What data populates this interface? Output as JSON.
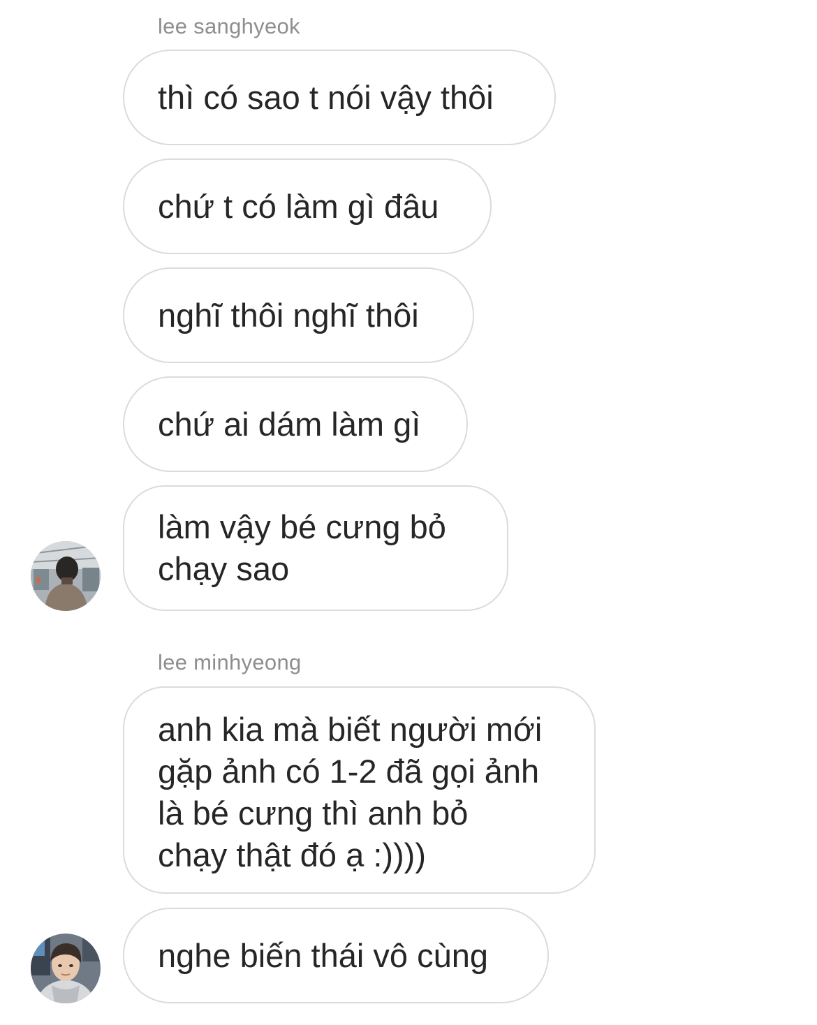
{
  "thread": {
    "groups": [
      {
        "sender": "lee sanghyeok",
        "avatar": "person-from-behind-avatar",
        "messages": [
          "thì có sao t nói vậy thôi",
          "chứ t có làm gì đâu",
          "nghĩ thôi nghĩ thôi",
          "chứ ai dám làm gì",
          "làm vậy bé cưng bỏ\nchạy sao"
        ]
      },
      {
        "sender": "lee minhyeong",
        "avatar": "selfie-portrait-avatar",
        "messages": [
          "anh kia mà biết người mới\ngặp ảnh có 1-2 đã gọi ảnh\nlà bé cưng thì anh bỏ\nchạy thật đó ạ :))))",
          "nghe biến thái vô cùng"
        ]
      }
    ]
  },
  "colors": {
    "bubble_border": "#dbdbdb",
    "text": "#262626",
    "sender_label": "#8e8e8e",
    "background": "#ffffff"
  }
}
